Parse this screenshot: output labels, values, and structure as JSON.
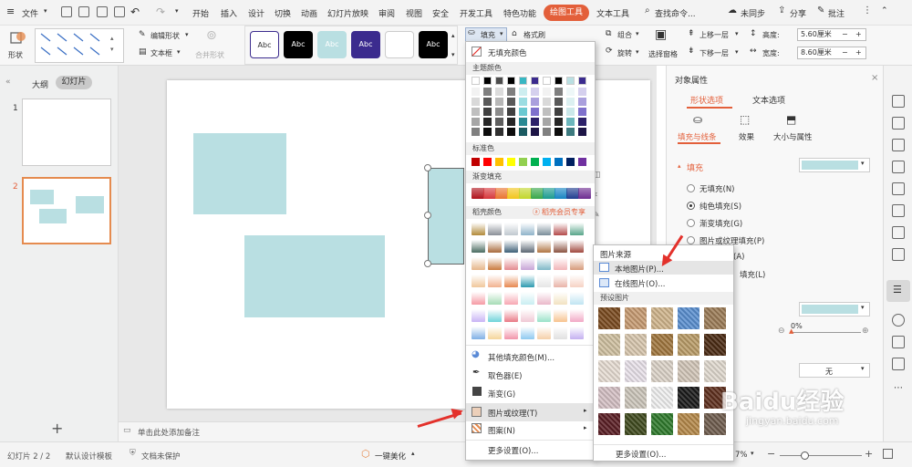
{
  "menu": {
    "file": "文件",
    "items": [
      "开始",
      "插入",
      "设计",
      "切换",
      "动画",
      "幻灯片放映",
      "审阅",
      "视图",
      "安全",
      "开发工具",
      "特色功能"
    ],
    "active_tab": "绘图工具",
    "text_tool": "文本工具",
    "search": "查找命令...",
    "sync": "未同步",
    "share": "分享",
    "comment": "批注"
  },
  "ribbon": {
    "shape": "形状",
    "edit_shape": "编辑形状",
    "textbox": "文本框",
    "merge_shape": "合并形状",
    "style_label": "Abc",
    "fill": "填充",
    "format_painter": "格式刷",
    "group": "组合",
    "rotate": "旋转",
    "selection_pane": "选择窗格",
    "bring_forward": "上移一层",
    "send_backward": "下移一层",
    "height_label": "高度:",
    "height_value": "5.60厘米",
    "width_label": "宽度:",
    "width_value": "8.60厘米"
  },
  "leftpanel": {
    "tab_outline": "大纲",
    "tab_slides": "幻灯片",
    "slide1_num": "1",
    "slide2_num": "2",
    "add": "+"
  },
  "notes": {
    "placeholder": "单击此处添加备注"
  },
  "status": {
    "slide": "幻灯片 2 / 2",
    "template": "默认设计模板",
    "protect": "文档未保护",
    "beautify": "一键美化",
    "zoom": "7%"
  },
  "rightpane": {
    "title": "对象属性",
    "tab_shape": "形状选项",
    "tab_text": "文本选项",
    "sub_fill_line": "填充与线条",
    "sub_effect": "效果",
    "sub_size": "大小与属性",
    "fill_header": "填充",
    "opt_none": "无填充(N)",
    "opt_solid": "纯色填充(S)",
    "opt_gradient": "渐变填充(G)",
    "opt_picture": "图片或纹理填充(P)",
    "opt_pattern_a": "(A)",
    "opt_pattern_fill": "填充(L)",
    "transparency": "0%",
    "none_label": "无"
  },
  "filldd": {
    "no_fill": "无填充颜色",
    "theme_colors": "主题颜色",
    "standard_colors": "标准色",
    "gradient_fill": "渐变填充",
    "shell_colors": "稻壳颜色",
    "shell_member": "稻壳会员专享",
    "more_colors": "其他填充颜色(M)...",
    "eyedropper": "取色器(E)",
    "gradient": "渐变(G)",
    "picture_texture": "图片或纹理(T)",
    "pattern": "图案(N)",
    "more_settings": "更多设置(O)..."
  },
  "submenu": {
    "source_header": "图片来源",
    "local_picture": "本地图片(P)...",
    "online_picture": "在线图片(O)...",
    "preset_header": "预设图片",
    "more_settings": "更多设置(O)..."
  },
  "watermark": {
    "text": "Baidu经验",
    "url": "jingyan.baidu.com"
  },
  "colors": {
    "accent": "#e35f3a",
    "shape_fill": "#b9dfe2",
    "arrow": "#e3312b"
  }
}
